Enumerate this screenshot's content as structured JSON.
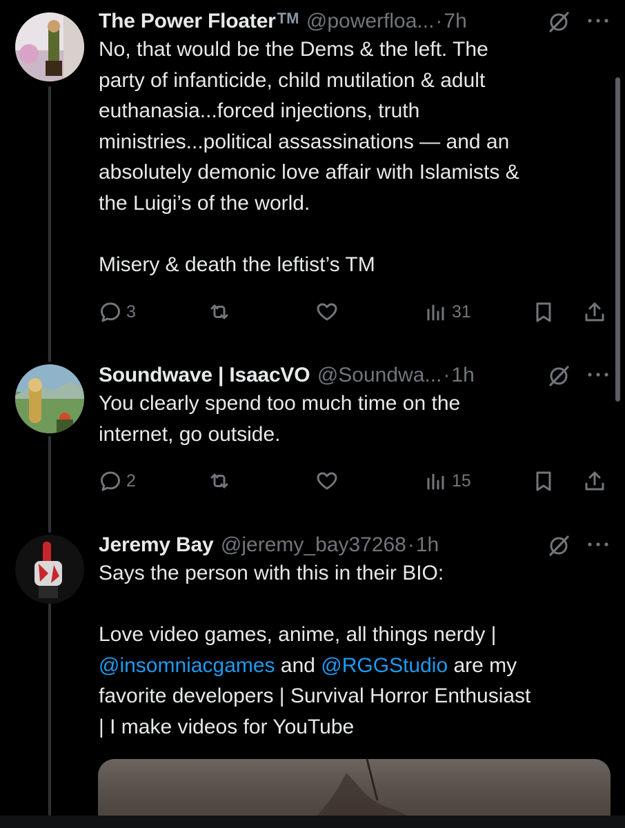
{
  "tweets": [
    {
      "name": "The Power Floater",
      "name_badge": "TM",
      "handle": "@powerfloa...",
      "time": "7h",
      "body": [
        "No, that would be the Dems & the left. The",
        "party of infanticide, child mutilation & adult",
        "euthanasia...forced injections, truth",
        "ministries...political assassinations — and an",
        "absolutely demonic love affair with Islamists &",
        "the Luigi’s of the world."
      ],
      "body2": "Misery & death the leftist’s TM",
      "replies": "3",
      "views": "31"
    },
    {
      "name": "Soundwave | IsaacVO",
      "handle": "@Soundwa...",
      "time": "1h",
      "body": [
        "You clearly spend too much time on the",
        "internet, go outside."
      ],
      "replies": "2",
      "views": "15"
    },
    {
      "name": "Jeremy Bay",
      "handle": "@jeremy_bay37268",
      "time": "1h",
      "body_intro": "Says the person with this in their BIO:",
      "bio_line1": "Love video games, anime, all things nerdy |",
      "mention1": "@insomniacgames",
      "and_text": " and ",
      "mention2": "@RGGStudio",
      "bio_line2_tail": " are my",
      "bio_line3": "favorite developers | Survival Horror Enthusiast",
      "bio_line4": "| I make videos for YouTube"
    }
  ],
  "separator_dot": "·",
  "colors": {
    "background": "#000000",
    "text": "#e7e9ea",
    "muted": "#71767b",
    "link": "#1d9bf0"
  },
  "icons": [
    "reply-icon",
    "retweet-icon",
    "like-icon",
    "views-icon",
    "bookmark-icon",
    "share-icon",
    "grok-icon",
    "more-icon"
  ]
}
